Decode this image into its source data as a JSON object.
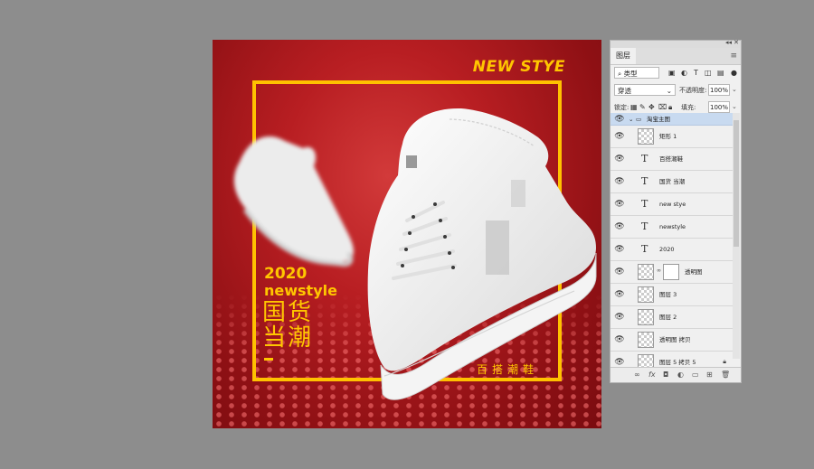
{
  "canvas": {
    "headline": "NEW STYE",
    "year": "2020",
    "subline": "newstyle",
    "cn_line1": "国货",
    "cn_line2": "当潮",
    "slogan": "百搭潮鞋",
    "colors": {
      "background": "#b81e22",
      "accent": "#ffc600"
    }
  },
  "layers_panel": {
    "tab_label": "图层",
    "filter_value": "类型",
    "blend_mode": "穿透",
    "opacity_label": "不透明度:",
    "opacity_value": "100%",
    "lock_label": "锁定:",
    "fill_label": "填充:",
    "fill_value": "100%",
    "group_name": "淘宝主图",
    "layers": [
      {
        "name": "矩形 1",
        "kind": "shape"
      },
      {
        "name": "百搭潮鞋",
        "kind": "text"
      },
      {
        "name": "国货 当潮",
        "kind": "text"
      },
      {
        "name": "new stye",
        "kind": "text"
      },
      {
        "name": "newstyle",
        "kind": "text"
      },
      {
        "name": "2020",
        "kind": "text"
      },
      {
        "name": "透明图",
        "kind": "masked"
      },
      {
        "name": "图层 3",
        "kind": "pixel"
      },
      {
        "name": "图层 2",
        "kind": "pixel"
      },
      {
        "name": "透明图 拷贝",
        "kind": "pixel"
      },
      {
        "name": "图层 5 拷贝 5",
        "kind": "pixel-locked"
      }
    ]
  }
}
